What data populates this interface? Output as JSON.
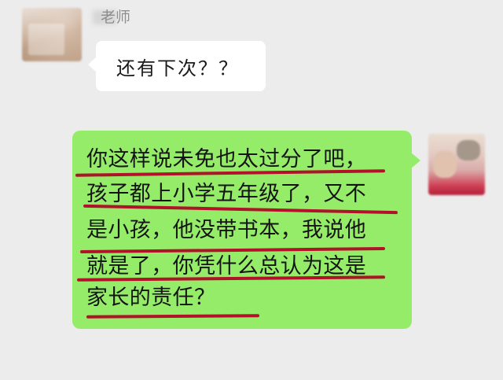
{
  "incoming": {
    "sender": "老师",
    "text": "还有下次？？"
  },
  "outgoing": {
    "lines": [
      "你这样说未免也太过分了吧，",
      "孩子都上小学五年级了，又不",
      "是小孩，他没带书本，我说他",
      "就是了，你凭什么总认为这是",
      "家长的责任？"
    ]
  },
  "colors": {
    "background": "#ececec",
    "incoming_bubble": "#ffffff",
    "outgoing_bubble": "#95ec69",
    "highlight_underline": "#b0122a"
  },
  "icons": {
    "left_avatar": "blurred-profile-avatar",
    "right_avatar": "blurred-profile-avatar"
  }
}
